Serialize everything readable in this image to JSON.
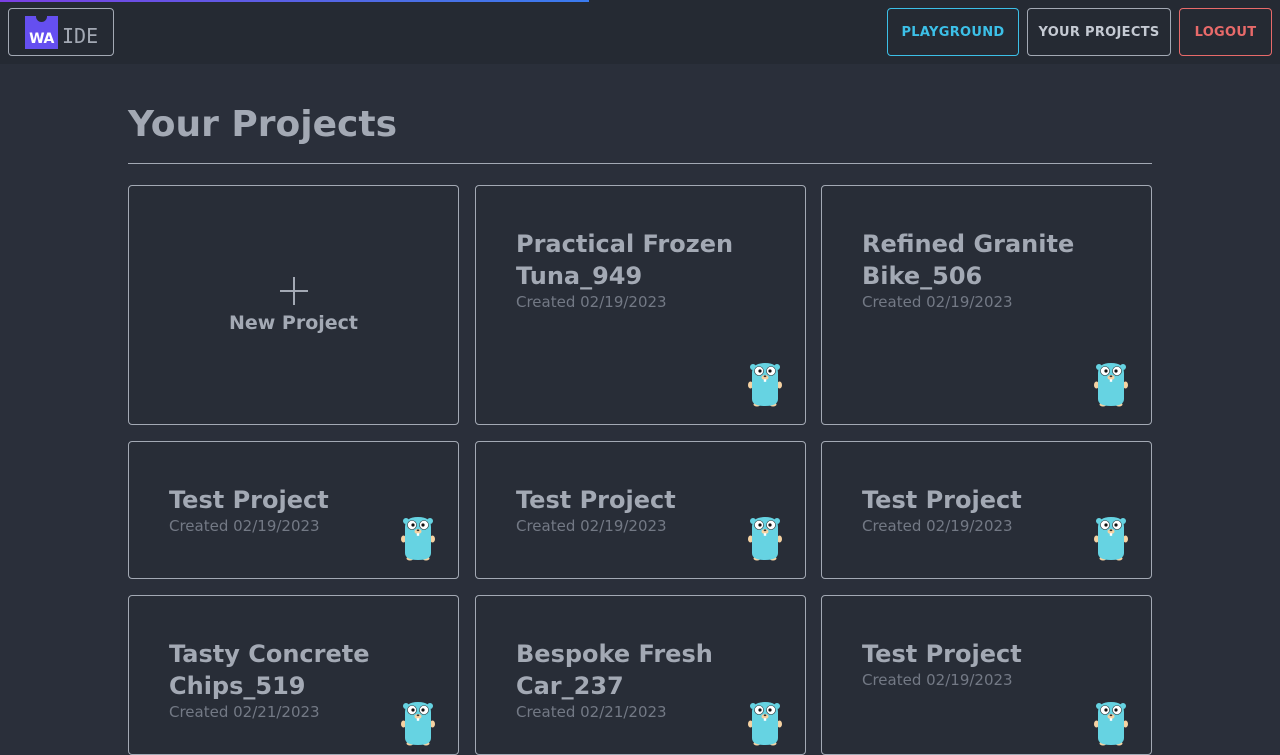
{
  "app": {
    "logo_mark_text": "WA",
    "logo_text": "IDE",
    "progress": 0.46
  },
  "nav": {
    "playground": "PLAYGROUND",
    "your_projects": "YOUR PROJECTS",
    "logout": "LOGOUT"
  },
  "main": {
    "title": "Your Projects",
    "new_project_label": "New Project",
    "projects": [
      {
        "name": "Practical Frozen Tuna_949",
        "created": "Created 02/19/2023"
      },
      {
        "name": "Refined Granite Bike_506",
        "created": "Created 02/19/2023"
      },
      {
        "name": "Test Project",
        "created": "Created 02/19/2023"
      },
      {
        "name": "Test Project",
        "created": "Created 02/19/2023"
      },
      {
        "name": "Test Project",
        "created": "Created 02/19/2023"
      },
      {
        "name": "Tasty Concrete Chips_519",
        "created": "Created 02/21/2023"
      },
      {
        "name": "Bespoke Fresh Car_237",
        "created": "Created 02/21/2023"
      },
      {
        "name": "Test Project",
        "created": "Created 02/19/2023"
      }
    ]
  },
  "colors": {
    "background": "#2a2f3a",
    "header": "#252a33",
    "logo_purple": "#654ff0",
    "playground_accent": "#3cc0e8",
    "logout_accent": "#e86a6a",
    "gopher": "#66d3e2"
  },
  "icons": {
    "new_project": "plus-icon",
    "project_mascot": "gopher-icon"
  }
}
